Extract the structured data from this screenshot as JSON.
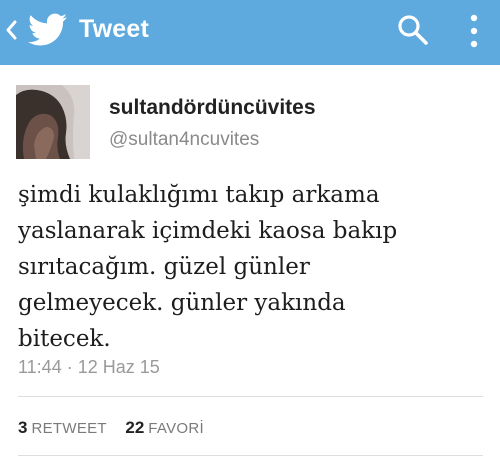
{
  "appbar": {
    "title": "Tweet",
    "back_icon": "chevron-left-icon",
    "logo_icon": "twitter-bird-icon",
    "search_icon": "search-icon",
    "menu_icon": "overflow-menu-icon",
    "color": "#5ea9dd"
  },
  "tweet": {
    "display_name": "sultandördüncüvites",
    "handle": "@sultan4ncuvites",
    "text_lines": [
      "şimdi kulaklığımı takıp arkama",
      "yaslanarak içimdeki kaosa bakıp",
      "sırıtacağım. güzel günler",
      "gelmeyecek. günler yakında",
      "bitecek."
    ],
    "timestamp": "11:44 · 12 Haz 15"
  },
  "stats": {
    "retweets_count": "3",
    "retweets_label": "RETWEET",
    "favorites_count": "22",
    "favorites_label": "FAVORİ"
  }
}
